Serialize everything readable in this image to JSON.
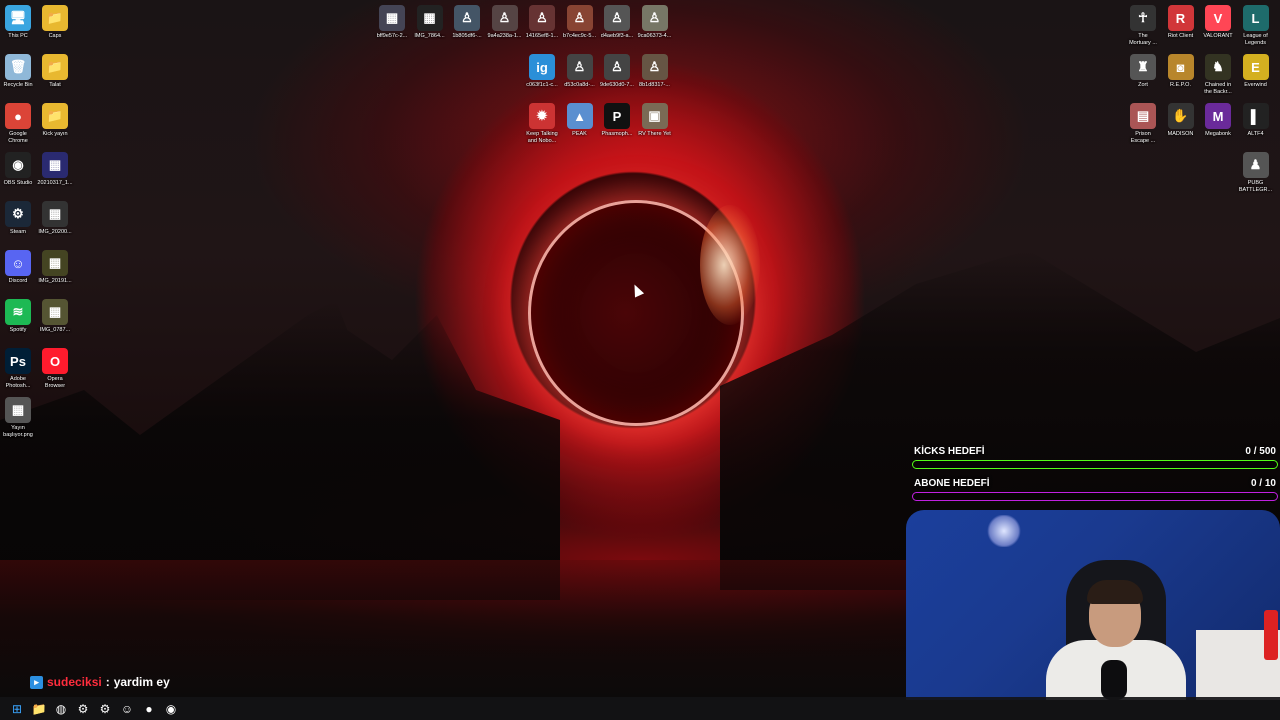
{
  "desktop": {
    "left_icons": [
      {
        "name": "this-pc-icon",
        "label": "This PC",
        "glyph": "🖥",
        "color": "#3aa5e0"
      },
      {
        "name": "folder-icon",
        "label": "Caps",
        "glyph": "📁",
        "color": "#e8b830"
      },
      {
        "name": "recycle-bin-icon",
        "label": "Recycle Bin",
        "glyph": "🗑",
        "color": "#8fb8d8"
      },
      {
        "name": "folder-icon",
        "label": "Talat",
        "glyph": "📁",
        "color": "#e8b830"
      },
      {
        "name": "chrome-icon",
        "label": "Google\nChrome",
        "glyph": "●",
        "color": "#db4437"
      },
      {
        "name": "folder-icon",
        "label": "Kick yayın",
        "glyph": "📁",
        "color": "#e8b830"
      },
      {
        "name": "obs-icon",
        "label": "OBS Studio",
        "glyph": "◉",
        "color": "#222"
      },
      {
        "name": "image-file-icon",
        "label": "20210317_1...",
        "glyph": "▦",
        "color": "#2a2a70"
      },
      {
        "name": "steam-icon",
        "label": "Steam",
        "glyph": "⚙",
        "color": "#1b2838"
      },
      {
        "name": "image-file-icon",
        "label": "IMG_20200...",
        "glyph": "▦",
        "color": "#333"
      },
      {
        "name": "discord-icon",
        "label": "Discord",
        "glyph": "☺",
        "color": "#5865f2"
      },
      {
        "name": "image-file-icon",
        "label": "IMG_20191...",
        "glyph": "▦",
        "color": "#442"
      },
      {
        "name": "spotify-icon",
        "label": "Spotify",
        "glyph": "≋",
        "color": "#1db954"
      },
      {
        "name": "image-file-icon",
        "label": "IMG_0787...",
        "glyph": "▦",
        "color": "#553"
      },
      {
        "name": "photoshop-icon",
        "label": "Adobe\nPhotosh...",
        "glyph": "Ps",
        "color": "#001e36"
      },
      {
        "name": "opera-icon",
        "label": "Opera\nBrowser",
        "glyph": "O",
        "color": "#ff1b2d"
      },
      {
        "name": "image-file-icon",
        "label": "Yayın\nbaşlıyor.png",
        "glyph": "▦",
        "color": "#555"
      }
    ],
    "top_icons": [
      {
        "name": "image-file-icon",
        "label": "bff9e57c-2...",
        "glyph": "▦",
        "color": "#445"
      },
      {
        "name": "image-file-icon",
        "label": "IMG_7864...",
        "glyph": "▦",
        "color": "#222"
      },
      {
        "name": "image-file-icon",
        "label": "1b805df6-...",
        "glyph": "♙",
        "color": "#456"
      },
      {
        "name": "image-file-icon",
        "label": "9a4a238a-1...",
        "glyph": "♙",
        "color": "#544"
      },
      {
        "name": "image-file-icon",
        "label": "14165ef8-1...",
        "glyph": "♙",
        "color": "#633"
      },
      {
        "name": "image-file-icon",
        "label": "b7c4ec9c-5...",
        "glyph": "♙",
        "color": "#843"
      },
      {
        "name": "image-file-icon",
        "label": "d4aeb9f3-a...",
        "glyph": "♙",
        "color": "#555"
      },
      {
        "name": "image-file-icon",
        "label": "9ca06373-4...",
        "glyph": "♙",
        "color": "#776"
      },
      {
        "name": "image-file-icon",
        "label": "c063f1c1-c...",
        "glyph": "ig",
        "color": "#2b8fd8"
      },
      {
        "name": "image-file-icon",
        "label": "d53c0a8d-...",
        "glyph": "♙",
        "color": "#444"
      },
      {
        "name": "image-file-icon",
        "label": "9de630d0-7...",
        "glyph": "♙",
        "color": "#444"
      },
      {
        "name": "image-file-icon",
        "label": "8b1d8317-...",
        "glyph": "♙",
        "color": "#654"
      },
      {
        "name": "game-icon",
        "label": "Keep Talking\nand Nobo...",
        "glyph": "✹",
        "color": "#c33"
      },
      {
        "name": "game-icon",
        "label": "PEAK",
        "glyph": "▲",
        "color": "#5a8fd0"
      },
      {
        "name": "game-icon",
        "label": "Phasmoph...",
        "glyph": "P",
        "color": "#111"
      },
      {
        "name": "game-icon",
        "label": "RV There Yet",
        "glyph": "▣",
        "color": "#7a6a55"
      }
    ],
    "right_icons": [
      {
        "name": "game-icon",
        "label": "The\nMortuary ...",
        "glyph": "☥",
        "color": "#333"
      },
      {
        "name": "riot-client-icon",
        "label": "Riot Client",
        "glyph": "R",
        "color": "#d13639"
      },
      {
        "name": "valorant-icon",
        "label": "VALORANT",
        "glyph": "V",
        "color": "#ff4655"
      },
      {
        "name": "league-icon",
        "label": "League of\nLegends",
        "glyph": "L",
        "color": "#1e6b6b"
      },
      {
        "name": "game-icon",
        "label": "Zort",
        "glyph": "♜",
        "color": "#555"
      },
      {
        "name": "game-icon",
        "label": "R.E.P.O.",
        "glyph": "◙",
        "color": "#b8862b"
      },
      {
        "name": "game-icon",
        "label": "Chained in\nthe Backr...",
        "glyph": "♞",
        "color": "#332"
      },
      {
        "name": "game-icon",
        "label": "Everwind",
        "glyph": "E",
        "color": "#d4b020"
      },
      {
        "name": "game-icon",
        "label": "Prison\nEscape ...",
        "glyph": "▤",
        "color": "#a55"
      },
      {
        "name": "game-icon",
        "label": "MADISON",
        "glyph": "✋",
        "color": "#333"
      },
      {
        "name": "game-icon",
        "label": "Megabonk",
        "glyph": "M",
        "color": "#6a2a9a"
      },
      {
        "name": "game-icon",
        "label": "ALTF4",
        "glyph": "▌",
        "color": "#222"
      },
      {
        "name": "pubg-icon",
        "label": "PUBG\nBATTLEGR...",
        "glyph": "♟",
        "color": "#555"
      }
    ]
  },
  "goals": {
    "kicks": {
      "label": "KİCKS HEDEFİ",
      "value": "0 / 500",
      "progress": 0,
      "color": "#53fc18"
    },
    "abone": {
      "label": "ABONE HEDEFİ",
      "value": "0 / 10",
      "progress": 0,
      "color": "#c020e0"
    }
  },
  "chat": {
    "user": "sudeciksi",
    "separator": " : ",
    "message": "yardim ey"
  },
  "taskbar": [
    {
      "name": "windows-start-icon",
      "glyph": "⊞"
    },
    {
      "name": "file-explorer-icon",
      "glyph": "📁"
    },
    {
      "name": "firefox-icon",
      "glyph": "◍"
    },
    {
      "name": "settings-icon",
      "glyph": "⚙"
    },
    {
      "name": "steam-icon",
      "glyph": "⚙"
    },
    {
      "name": "discord-icon",
      "glyph": "☺"
    },
    {
      "name": "spotify-icon",
      "glyph": "●"
    },
    {
      "name": "chrome-icon",
      "glyph": "◉"
    }
  ]
}
